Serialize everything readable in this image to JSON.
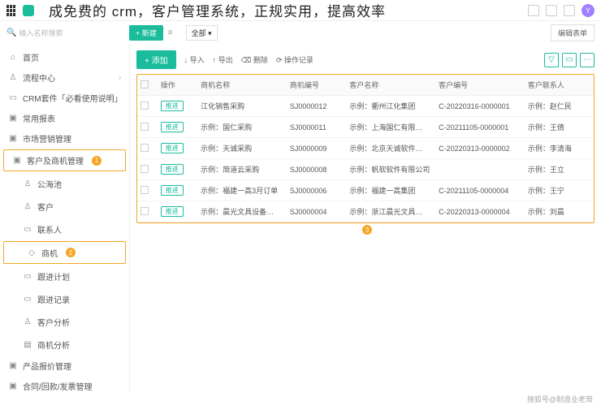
{
  "tagline": "成免费的 crm，客户管理系统，正规实用，提高效率",
  "avatar": "Y",
  "search_ph": "输入名称搜索",
  "new_btn": "+ 新建",
  "list_icon": "≡",
  "all_tab": "全部 ▾",
  "edit_form": "编辑表单",
  "sidebar": [
    {
      "ic": "⌂",
      "t": "首页"
    },
    {
      "ic": "♙",
      "t": "流程中心",
      "chev": true
    },
    {
      "ic": "▭",
      "t": "CRM套件「必看使用说明」"
    },
    {
      "ic": "▣",
      "t": "常用报表"
    },
    {
      "ic": "▣",
      "t": "市场营销管理"
    },
    {
      "ic": "▣",
      "t": "客户及商机管理",
      "badge": "1",
      "hl": true
    },
    {
      "ic": "♙",
      "t": "公海池",
      "sub": true
    },
    {
      "ic": "♙",
      "t": "客户",
      "sub": true
    },
    {
      "ic": "▭",
      "t": "联系人",
      "sub": true
    },
    {
      "ic": "◇",
      "t": "商机",
      "sub": true,
      "badge": "2",
      "hl": true
    },
    {
      "ic": "▭",
      "t": "跟进计划",
      "sub": true
    },
    {
      "ic": "▭",
      "t": "跟进记录",
      "sub": true
    },
    {
      "ic": "♙",
      "t": "客户分析",
      "sub": true
    },
    {
      "ic": "▤",
      "t": "商机分析",
      "sub": true
    },
    {
      "ic": "▣",
      "t": "产品报价管理"
    },
    {
      "ic": "▣",
      "t": "合同/回款/发票管理"
    }
  ],
  "toolbar": {
    "add": "+ 添加",
    "import": "↓ 导入",
    "export": "↑ 导出",
    "delete": "⌫ 删除",
    "log": "⟳ 操作记录"
  },
  "headers": [
    "",
    "操作",
    "商机名称",
    "商机编号",
    "客户名称",
    "客户编号",
    "客户联系人"
  ],
  "rows": [
    [
      "推进",
      "江化销售采购",
      "SJ0000012",
      "示例：衢州江化集团",
      "C-20220316-0000001",
      "示例：赵仁民"
    ],
    [
      "推进",
      "示例：国仁采购",
      "SJ0000011",
      "示例：上海国仁有限…",
      "C-20211105-0000001",
      "示例：王倩"
    ],
    [
      "推进",
      "示例：天诚采购",
      "SJ0000009",
      "示例：北京天诚软件…",
      "C-20220313-0000002",
      "示例：李清海"
    ],
    [
      "推进",
      "示例：简道云采购",
      "SJ0000008",
      "示例：帆软软件有限公司",
      "",
      "示例：王立"
    ],
    [
      "推进",
      "示例：福建一高3月订单",
      "SJ0000006",
      "示例：福建一高集团",
      "C-20211105-0000004",
      "示例：王宁"
    ],
    [
      "推进",
      "示例：晨光文具设备…",
      "SJ0000004",
      "示例：浙江晨光文具…",
      "C-20220313-0000004",
      "示例：刘晨"
    ]
  ],
  "table_badge": "3",
  "souhu": "搜狐号@制造业老简"
}
